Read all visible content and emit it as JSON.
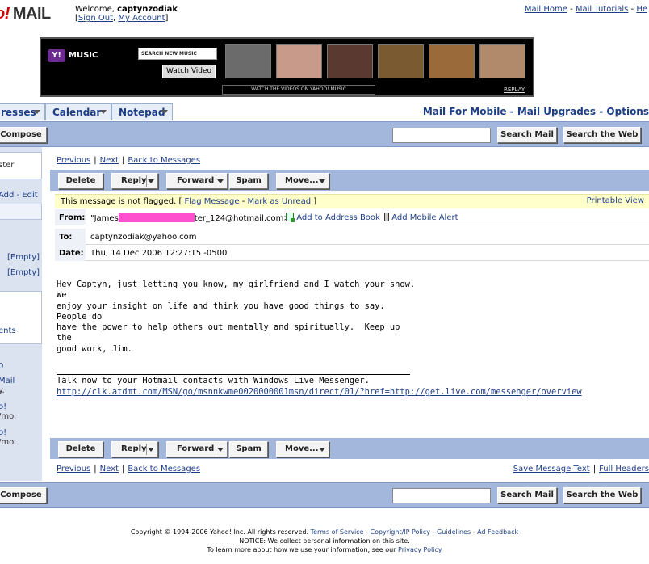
{
  "header": {
    "logo_bang": "o!",
    "logo_mail": "MAIL",
    "welcome_prefix": "Welcome,",
    "username": "captynzodiak",
    "sign_out": "Sign Out",
    "my_account": "My Account",
    "top_links": [
      "Mail Home",
      "Mail Tutorials",
      "He"
    ]
  },
  "banner": {
    "music_label": "MUSIC",
    "music_badge": "Y!",
    "search_placeholder": "SEARCH NEW MUSIC",
    "watch_button": "Watch Video",
    "caption": "WATCH THE VIDEOS ON YAHOO! MUSIC",
    "replay": "REPLAY",
    "thumb_colors": [
      "#6b6b6b",
      "#c89a8a",
      "#5a3a30",
      "#7a5a30",
      "#9a6a3a",
      "#b08a6a"
    ]
  },
  "tabs": [
    "resses",
    "Calendar",
    "Notepad"
  ],
  "right_links": [
    "Mail For Mobile",
    "Mail Upgrades",
    "Options"
  ],
  "toolbar": {
    "compose": "Compose",
    "search_mail": "Search Mail",
    "search_web": "Search the Web"
  },
  "sidebar": {
    "items": [
      "ster",
      "Add - Edit",
      "[Empty]",
      "[Empty]",
      "ents",
      "0",
      "Mail",
      "y.",
      "o!",
      "/mo.",
      "o!",
      "/mo."
    ]
  },
  "message": {
    "nav": {
      "previous": "Previous",
      "next": "Next",
      "back": "Back to Messages"
    },
    "actions": {
      "delete": "Delete",
      "reply": "Reply",
      "forward": "Forward",
      "spam": "Spam",
      "move": "Move..."
    },
    "flag_text": "This message is not flagged.",
    "flag_message": "Flag Message",
    "mark_unread": "Mark as Unread",
    "printable": "Printable View",
    "from_label": "From:",
    "from_prefix": "\"James",
    "from_suffix": "ter_124@hotmail.com>",
    "add_address": "Add to Address Book",
    "add_mobile": "Add Mobile Alert",
    "to_label": "To:",
    "to_value": "captynzodiak@yahoo.com",
    "date_label": "Date:",
    "date_value": "Thu, 14 Dec 2006 12:27:15 -0500",
    "body": "Hey Captyn, just letting you know, my girlfriend and I watch your show.\nWe\nenjoy your insight on life and think you have good things to say.\nPeople do\nhave the power to help others out mentally and spiritually.  Keep up\nthe\ngood work, Jim.",
    "sig_text": "Talk now to your Hotmail contacts with Windows Live Messenger.",
    "sig_link": "http://clk.atdmt.com/MSN/go/msnnkwme0020000001msn/direct/01/?href=http://get.live.com/messenger/overview",
    "save_text": "Save Message Text",
    "full_headers": "Full Headers"
  },
  "footer": {
    "line1_prefix": "Copyright © 1994-2006 Yahoo! Inc. All rights reserved.",
    "terms": "Terms of Service",
    "copyright_policy": "Copyright/IP Policy",
    "guidelines": "Guidelines",
    "ad_feedback": "Ad Feedback",
    "line2": "NOTICE: We collect personal information on this site.",
    "line3_prefix": "To learn more about how we use your information, see our",
    "privacy": "Privacy Policy"
  }
}
